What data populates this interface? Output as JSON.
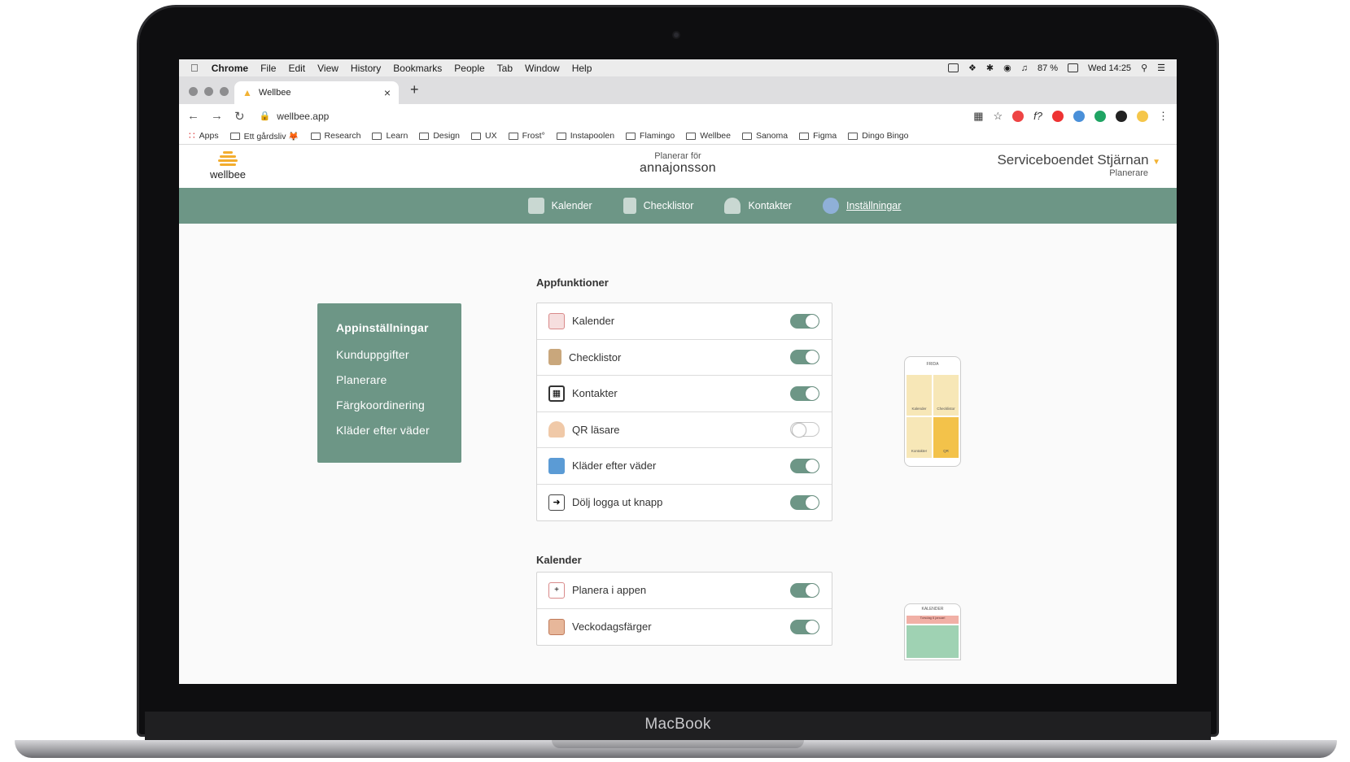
{
  "device": {
    "label": "MacBook"
  },
  "os_menubar": {
    "app": "Chrome",
    "menus": [
      "File",
      "Edit",
      "View",
      "History",
      "Bookmarks",
      "People",
      "Tab",
      "Window",
      "Help"
    ],
    "battery": "87 %",
    "clock": "Wed 14:25"
  },
  "browser": {
    "tab_title": "Wellbee",
    "url": "wellbee.app",
    "bookmarks": [
      "Apps",
      "Ett gårdsliv 🦊",
      "Research",
      "Learn",
      "Design",
      "UX",
      "Frost°",
      "Instapoolen",
      "Flamingo",
      "Wellbee",
      "Sanoma",
      "Figma",
      "Dingo Bingo"
    ]
  },
  "header": {
    "logo_text": "wellbee",
    "planning_for_label": "Planerar för",
    "user": "annajonsson",
    "organization": "Serviceboendet Stjärnan",
    "role": "Planerare"
  },
  "nav": [
    {
      "label": "Kalender",
      "icon": "calendar-icon"
    },
    {
      "label": "Checklistor",
      "icon": "checklist-icon"
    },
    {
      "label": "Kontakter",
      "icon": "contacts-icon"
    },
    {
      "label": "Inställningar",
      "icon": "gear-icon",
      "active": true
    }
  ],
  "side_menu": [
    {
      "label": "Appinställningar",
      "active": true
    },
    {
      "label": "Kunduppgifter"
    },
    {
      "label": "Planerare"
    },
    {
      "label": "Färgkoordinering"
    },
    {
      "label": "Kläder efter väder"
    }
  ],
  "sections": [
    {
      "title": "Appfunktioner",
      "rows": [
        {
          "label": "Kalender",
          "on": true,
          "icon": "calendar-icon"
        },
        {
          "label": "Checklistor",
          "on": true,
          "icon": "checklist-icon"
        },
        {
          "label": "Kontakter",
          "on": true,
          "icon": "qr-contacts-icon"
        },
        {
          "label": "QR läsare",
          "on": false,
          "icon": "person-icon"
        },
        {
          "label": "Kläder efter väder",
          "on": true,
          "icon": "shirt-icon"
        },
        {
          "label": "Dölj logga ut knapp",
          "on": true,
          "icon": "logout-icon"
        }
      ]
    },
    {
      "title": "Kalender",
      "rows": [
        {
          "label": "Planera i appen",
          "on": true,
          "icon": "calendar-plus-icon"
        },
        {
          "label": "Veckodagsfärger",
          "on": true,
          "icon": "calendar-icon"
        }
      ]
    }
  ],
  "preview_phone": {
    "name": "FRIDA",
    "cells": [
      "Kalender",
      "Checklistor",
      "Kontakter",
      "QR"
    ],
    "second_header": "KALENDER",
    "second_subtitle": "Torsdag 6 januari"
  },
  "colors": {
    "brand_green": "#6d9686",
    "accent_yellow": "#f2b233"
  }
}
